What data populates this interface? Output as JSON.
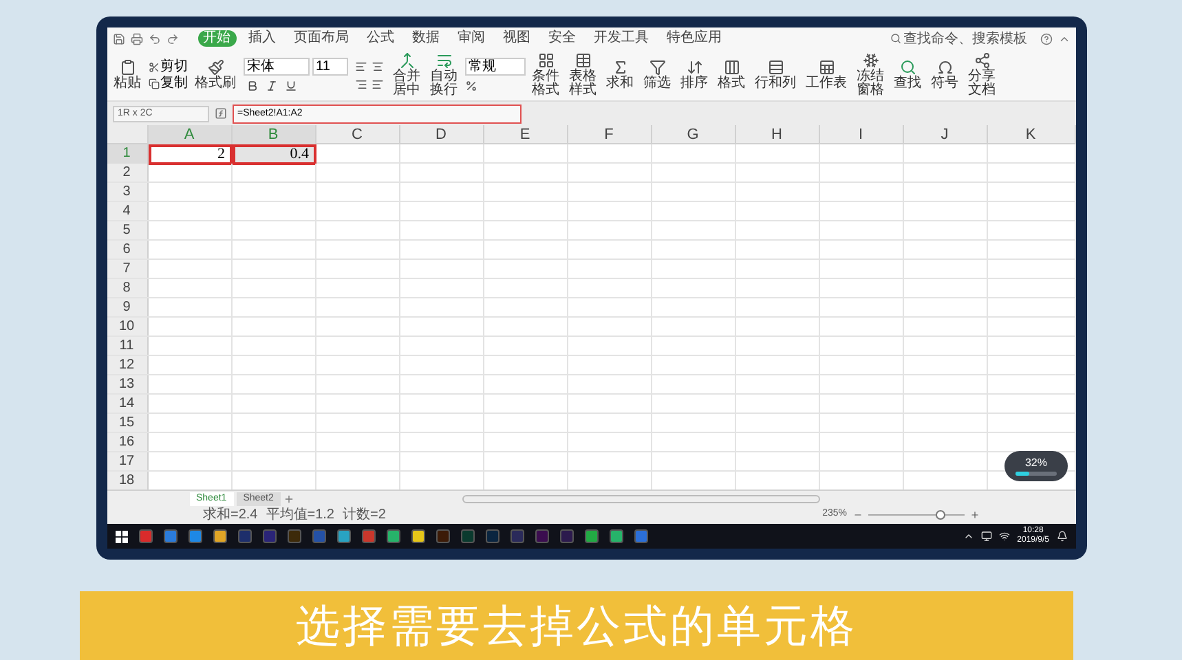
{
  "ribbon_tabs": [
    {
      "label": "开始",
      "selected": true
    },
    {
      "label": "插入",
      "selected": false
    },
    {
      "label": "页面布局",
      "selected": false
    },
    {
      "label": "公式",
      "selected": false
    },
    {
      "label": "数据",
      "selected": false
    },
    {
      "label": "审阅",
      "selected": false
    },
    {
      "label": "视图",
      "selected": false
    },
    {
      "label": "安全",
      "selected": false
    },
    {
      "label": "开发工具",
      "selected": false
    },
    {
      "label": "特色应用",
      "selected": false
    }
  ],
  "search": {
    "placeholder": "查找命令、搜索模板"
  },
  "clipboard": {
    "paste": "粘贴",
    "cut": "剪切",
    "copy": "复制",
    "painter": "格式刷"
  },
  "font": {
    "name": "宋体",
    "size": "11"
  },
  "tools_left": [
    {
      "label": "合并居中"
    },
    {
      "label": "自动换行"
    }
  ],
  "number_format": "常规",
  "tools_right": [
    {
      "label": "条件格式"
    },
    {
      "label": "表格样式"
    },
    {
      "label": "求和"
    },
    {
      "label": "筛选"
    },
    {
      "label": "排序"
    },
    {
      "label": "格式"
    },
    {
      "label": "行和列"
    },
    {
      "label": "工作表"
    },
    {
      "label": "冻结窗格"
    },
    {
      "label": "查找"
    },
    {
      "label": "符号"
    },
    {
      "label": "分享文档"
    }
  ],
  "name_box": "1R x 2C",
  "formula": {
    "value": "=Sheet2!A1:A2",
    "highlighted": true
  },
  "columns": [
    {
      "label": "A",
      "selected": true
    },
    {
      "label": "B",
      "selected": true
    },
    {
      "label": "C",
      "selected": false
    },
    {
      "label": "D",
      "selected": false
    },
    {
      "label": "E",
      "selected": false
    },
    {
      "label": "F",
      "selected": false
    },
    {
      "label": "G",
      "selected": false
    },
    {
      "label": "H",
      "selected": false
    },
    {
      "label": "I",
      "selected": false
    },
    {
      "label": "J",
      "selected": false
    },
    {
      "label": "K",
      "selected": false
    }
  ],
  "rows": [
    {
      "header": "1",
      "selected": true,
      "cells": [
        {
          "value": "2",
          "selected": true
        },
        {
          "value": "0.4",
          "selected": true
        }
      ]
    },
    {
      "header": "2",
      "selected": false,
      "cells": []
    },
    {
      "header": "3",
      "selected": false,
      "cells": []
    },
    {
      "header": "4",
      "selected": false,
      "cells": []
    },
    {
      "header": "5",
      "selected": false,
      "cells": []
    },
    {
      "header": "6",
      "selected": false,
      "cells": []
    },
    {
      "header": "7",
      "selected": false,
      "cells": []
    },
    {
      "header": "8",
      "selected": false,
      "cells": []
    },
    {
      "header": "9",
      "selected": false,
      "cells": []
    },
    {
      "header": "10",
      "selected": false,
      "cells": []
    },
    {
      "header": "11",
      "selected": false,
      "cells": []
    },
    {
      "header": "12",
      "selected": false,
      "cells": []
    },
    {
      "header": "13",
      "selected": false,
      "cells": []
    },
    {
      "header": "14",
      "selected": false,
      "cells": []
    },
    {
      "header": "15",
      "selected": false,
      "cells": []
    },
    {
      "header": "16",
      "selected": false,
      "cells": []
    },
    {
      "header": "17",
      "selected": false,
      "cells": []
    },
    {
      "header": "18",
      "selected": false,
      "cells": []
    }
  ],
  "sheets": [
    {
      "label": "Sheet1",
      "selected": true
    },
    {
      "label": "Sheet2",
      "selected": false
    }
  ],
  "status": [
    "求和=2.4",
    "平均值=1.2",
    "计数=2"
  ],
  "zoom": {
    "reading": "235%",
    "level": 0.75
  },
  "meter": {
    "reading": "32%",
    "level": 0.32
  },
  "clock": {
    "time": "10:28",
    "date": "2019/9/5"
  },
  "caption": "选择需要去掉公式的单元格"
}
